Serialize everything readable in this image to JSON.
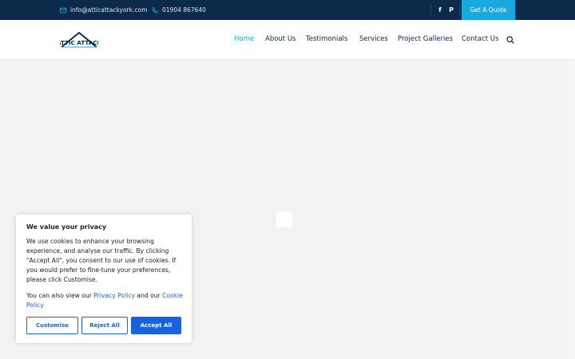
{
  "topbar": {
    "email": "info@atticattackyork.com",
    "phone": "01904 867640",
    "social": {
      "facebook": "f",
      "pinterest": "P"
    },
    "quote_label": "Get A Quote",
    "icons": {
      "email": "envelope-icon",
      "phone": "phone-icon"
    }
  },
  "header": {
    "logo_text": "ATTIC ATTACK",
    "nav": [
      {
        "label": "Home",
        "active": true
      },
      {
        "label": "About Us"
      },
      {
        "label": "Testimonials"
      },
      {
        "label": "Services"
      },
      {
        "label": "Project Galleries"
      },
      {
        "label": "Contact Us"
      }
    ],
    "search_icon": "search-icon"
  },
  "cookie": {
    "title": "We value your privacy",
    "body": "We use cookies to enhance your browsing experience, and analyse our traffic. By clicking \"Accept All\", you consent to our use of cookies.  If you would prefer to  fine-tune your preferences, please click Customise.",
    "view_prefix": "You can also view our ",
    "privacy_link": "Privacy Policy",
    "view_mid": " and our ",
    "cookie_link": "Cookie Policy",
    "customise_label": "Customise",
    "reject_label": "Reject All",
    "accept_label": "Accept All"
  },
  "colors": {
    "topbar_bg": "#0c2a4a",
    "accent": "#1aa8e0",
    "cookie_blue": "#1863dc"
  }
}
